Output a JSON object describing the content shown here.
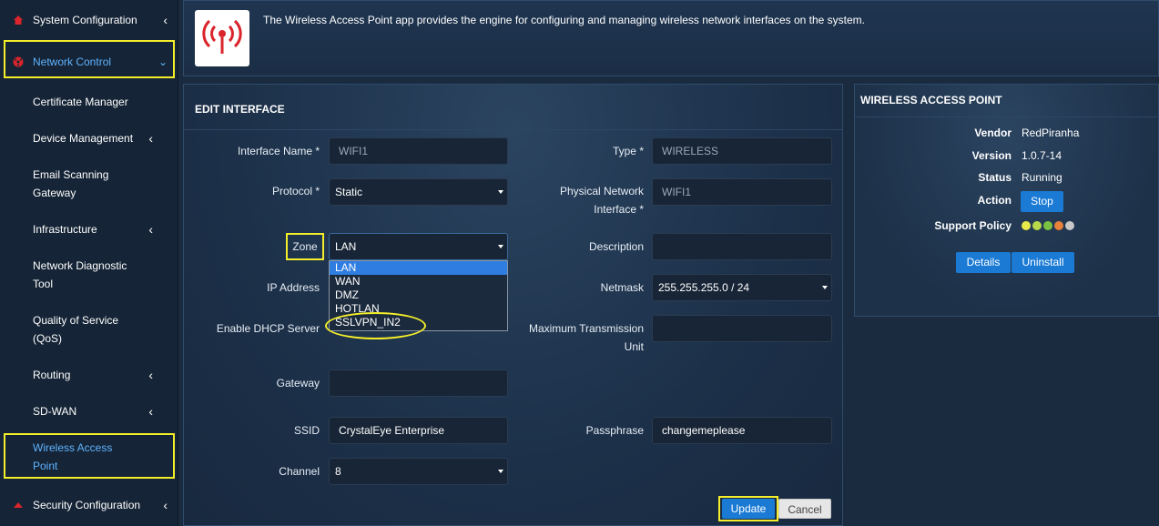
{
  "sidebar": {
    "items": [
      {
        "label": "System Configuration",
        "has_chevron": true,
        "icon": "home-icon"
      },
      {
        "label": "Network Control",
        "has_chevron": true,
        "icon": "network-icon",
        "active": true
      },
      {
        "label": "Certificate Manager"
      },
      {
        "label": "Device Management",
        "has_chevron": true
      },
      {
        "label": "Email Scanning",
        "label2": "Gateway"
      },
      {
        "label": "Infrastructure",
        "has_chevron": true
      },
      {
        "label": "Network Diagnostic",
        "label2": "Tool"
      },
      {
        "label": "Quality of Service",
        "label2": "(QoS)"
      },
      {
        "label": "Routing",
        "has_chevron": true
      },
      {
        "label": "SD-WAN",
        "has_chevron": true
      },
      {
        "label": "Wireless Access",
        "label2": "Point",
        "active": true
      },
      {
        "label": "Security Configuration",
        "has_chevron": true,
        "icon": "security-icon"
      }
    ]
  },
  "banner": {
    "icon": "wireless-antenna-icon",
    "description": "The Wireless Access Point app provides the engine for configuring and managing wireless network interfaces on the system."
  },
  "edit": {
    "title": "EDIT INTERFACE",
    "interface_name_label": "Interface Name *",
    "interface_name_value": "WIFI1",
    "type_label": "Type *",
    "type_value": "WIRELESS",
    "protocol_label": "Protocol *",
    "protocol_value": "Static",
    "phys_label_1": "Physical Network",
    "phys_label_2": "Interface *",
    "phys_value": "WIFI1",
    "zone_label": "Zone",
    "zone_value": "LAN",
    "zone_options": [
      "LAN",
      "WAN",
      "DMZ",
      "HOTLAN",
      "SSLVPN_IN2"
    ],
    "description_label": "Description",
    "description_value": "",
    "ip_label": "IP Address",
    "netmask_label": "Netmask",
    "netmask_value": "255.255.255.0 / 24",
    "dhcp_label": "Enable DHCP Server",
    "mtu_label_1": "Maximum Transmission",
    "mtu_label_2": "Unit",
    "mtu_value": "",
    "gateway_label": "Gateway",
    "gateway_value": "",
    "ssid_label": "SSID",
    "ssid_value": "CrystalEye Enterprise",
    "passphrase_label": "Passphrase",
    "passphrase_value": "changemeplease",
    "channel_label": "Channel",
    "channel_value": "8",
    "update_label": "Update",
    "cancel_label": "Cancel"
  },
  "info": {
    "title": "WIRELESS ACCESS POINT",
    "vendor_label": "Vendor",
    "vendor_value": "RedPiranha",
    "version_label": "Version",
    "version_value": "1.0.7-14",
    "status_label": "Status",
    "status_value": "Running",
    "action_label": "Action",
    "stop_label": "Stop",
    "support_label": "Support Policy",
    "support_dot_colors": [
      "#e8e84a",
      "#b6d84a",
      "#7cc242",
      "#e8813a",
      "#c8c8c8"
    ],
    "details_label": "Details",
    "uninstall_label": "Uninstall"
  },
  "colors": {
    "highlight": "#f4ee2a",
    "accent": "#1a7ad4",
    "icon_red": "#d9252b"
  }
}
